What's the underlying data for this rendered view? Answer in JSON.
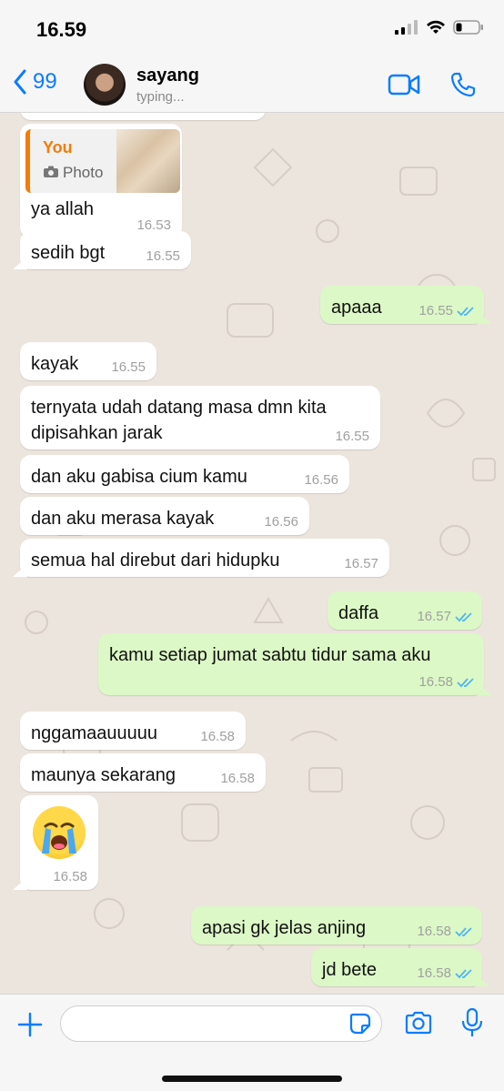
{
  "status_bar": {
    "time": "16.59",
    "signal_icon": "signal-bars-icon",
    "wifi_icon": "wifi-icon",
    "battery_icon": "battery-icon"
  },
  "header": {
    "back_icon": "chevron-left-icon",
    "back_count": "99",
    "contact_name": "sayang",
    "contact_status": "typing...",
    "video_icon": "video-camera-icon",
    "call_icon": "phone-icon",
    "accent_color": "#0a7cff"
  },
  "messages": [
    {
      "dir": "in",
      "reply": {
        "author": "You",
        "type": "Photo"
      },
      "text": "ya allah",
      "time": "16.53"
    },
    {
      "dir": "in",
      "text": "sedih bgt",
      "time": "16.55"
    },
    {
      "dir": "out",
      "text": "apaaa",
      "time": "16.55"
    },
    {
      "dir": "in",
      "text": "kayak",
      "time": "16.55"
    },
    {
      "dir": "in",
      "text": "ternyata udah datang masa dmn kita dipisahkan jarak",
      "time": "16.55"
    },
    {
      "dir": "in",
      "text": "dan aku gabisa cium kamu",
      "time": "16.56"
    },
    {
      "dir": "in",
      "text": "dan aku merasa kayak",
      "time": "16.56"
    },
    {
      "dir": "in",
      "text": "semua hal direbut dari hidupku",
      "time": "16.57"
    },
    {
      "dir": "out",
      "text": "daffa",
      "time": "16.57"
    },
    {
      "dir": "out",
      "text": "kamu setiap jumat sabtu tidur sama aku",
      "time": "16.58"
    },
    {
      "dir": "in",
      "text": "nggamaauuuuu",
      "time": "16.58"
    },
    {
      "dir": "in",
      "text": "maunya sekarang",
      "time": "16.58"
    },
    {
      "dir": "in",
      "emoji": "loudly-crying-face",
      "time": "16.58"
    },
    {
      "dir": "out",
      "text": "apasi gk jelas anjing",
      "time": "16.58"
    },
    {
      "dir": "out",
      "text": "jd bete",
      "time": "16.58"
    }
  ],
  "input_bar": {
    "plus_icon": "plus-icon",
    "sticker_icon": "sticker-icon",
    "camera_icon": "camera-icon",
    "mic_icon": "microphone-icon"
  },
  "colors": {
    "incoming_bubble": "#ffffff",
    "outgoing_bubble": "#dcf8c6",
    "read_tick": "#4fb6ec",
    "chat_bg": "#ece5dd"
  }
}
